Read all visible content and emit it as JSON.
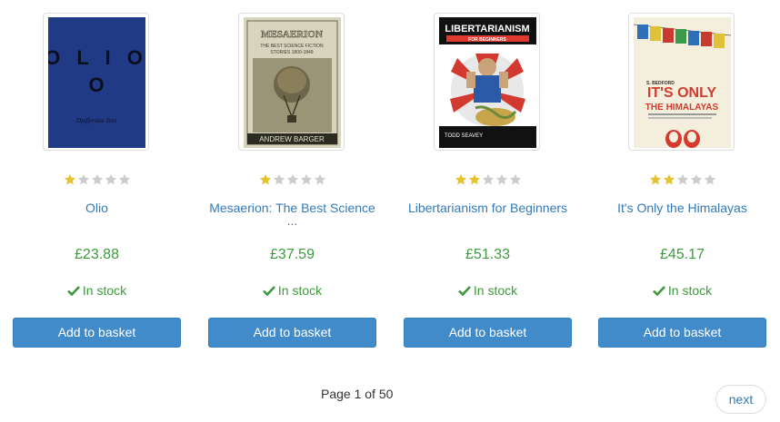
{
  "products": [
    {
      "title": "Olio",
      "title_line2": "",
      "price": "£23.88",
      "availability": "In stock",
      "rating": 1,
      "button_label": "Add to basket",
      "cover": {
        "top_lines": [
          "O L I O",
          "O"
        ],
        "bottom": "Djaffertine Jess"
      }
    },
    {
      "title": "Mesaerion: The Best Science",
      "title_line2": "...",
      "price": "£37.59",
      "availability": "In stock",
      "rating": 1,
      "button_label": "Add to basket",
      "cover": {
        "top_lines": [
          "MESAERION",
          "THE BEST SCIENCE FICTION",
          "STORIES 1800-1849"
        ],
        "bottom": "ANDREW BARGER"
      }
    },
    {
      "title": "Libertarianism for Beginners",
      "title_line2": "",
      "price": "£51.33",
      "availability": "In stock",
      "rating": 2,
      "button_label": "Add to basket",
      "cover": {
        "top_lines": [
          "LIBERTARIANISM",
          "FOR BEGINNERS"
        ],
        "bottom": "TODD SEAVEY"
      }
    },
    {
      "title": "It's Only the Himalayas",
      "title_line2": "",
      "price": "£45.17",
      "availability": "In stock",
      "rating": 2,
      "button_label": "Add to basket",
      "cover": {
        "top_lines": [
          "S. BEDFORD",
          "IT'S ONLY",
          "THE HIMALAYAS"
        ],
        "bottom": ""
      }
    }
  ],
  "pagination": {
    "current": "Page 1 of 50",
    "next": "next"
  },
  "colors": {
    "accent": "#428bca",
    "link": "#337ab7",
    "in_stock": "#3c9a3c",
    "star_on": "#e6c22f",
    "star_off": "#cccccc"
  },
  "icons": {
    "rating": "star-icon",
    "availability": "check-icon"
  }
}
